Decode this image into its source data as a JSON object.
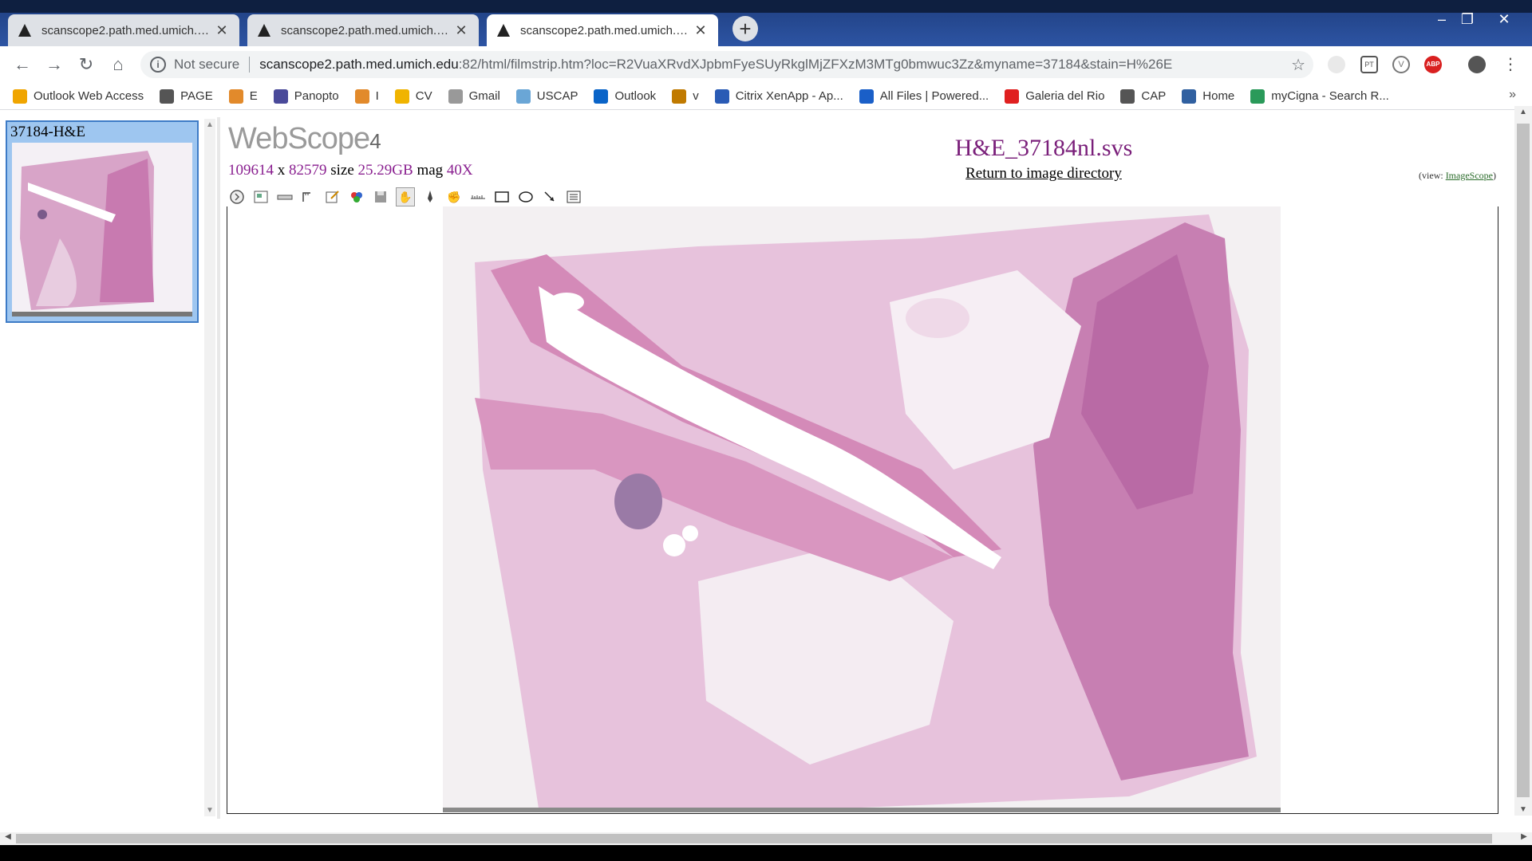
{
  "tabs": [
    {
      "title": "scanscope2.path.med.umich.edu",
      "active": false
    },
    {
      "title": "scanscope2.path.med.umich.edu",
      "active": false
    },
    {
      "title": "scanscope2.path.med.umich.edu",
      "active": true
    }
  ],
  "address": {
    "security": "Not secure",
    "host": "scanscope2.path.med.umich.edu",
    "path": ":82/html/filmstrip.htm?loc=R2VuaXRvdXJpbmFyeSUyRkglMjZFXzM3MTg0bmwuc3Zz&myname=37184&stain=H%26E"
  },
  "bookmarks": [
    {
      "label": "Outlook Web Access",
      "icon": "outlook-square-icon",
      "color": "#f0a500"
    },
    {
      "label": "PAGE",
      "icon": "globe-icon",
      "color": "#555555"
    },
    {
      "label": "E",
      "icon": "e-letter-icon",
      "color": "#e28a2b"
    },
    {
      "label": "Panopto",
      "icon": "panopto-icon",
      "color": "#4a4a9a"
    },
    {
      "label": "I",
      "icon": "e-letter-icon",
      "color": "#e28a2b"
    },
    {
      "label": "CV",
      "icon": "folder-people-icon",
      "color": "#f0b400"
    },
    {
      "label": "Gmail",
      "icon": "loading-icon",
      "color": "#999999"
    },
    {
      "label": "USCAP",
      "icon": "cloud-icon",
      "color": "#6aa6d6"
    },
    {
      "label": "Outlook",
      "icon": "outlook-icon",
      "color": "#0a64c8"
    },
    {
      "label": "v",
      "icon": "v-letter-icon",
      "color": "#c07a00"
    },
    {
      "label": "Citrix XenApp - Ap...",
      "icon": "citrix-icon",
      "color": "#2a5bb5"
    },
    {
      "label": "All Files | Powered...",
      "icon": "box-icon",
      "color": "#1a5fc8"
    },
    {
      "label": "Galeria del Rio",
      "icon": "red-square-icon",
      "color": "#e02020"
    },
    {
      "label": "CAP",
      "icon": "globe-icon",
      "color": "#555555"
    },
    {
      "label": "Home",
      "icon": "ae-icon",
      "color": "#3060a0"
    },
    {
      "label": "myCigna - Search R...",
      "icon": "cigna-tree-icon",
      "color": "#2a9a5a"
    }
  ],
  "filmstrip": {
    "items": [
      {
        "label": "37184-H&E"
      }
    ]
  },
  "viewer": {
    "logo": "WebScope",
    "logo_version": "4",
    "width": "109614",
    "x": "x",
    "height": "82579",
    "size_label": "size",
    "size": "25.29GB",
    "mag_label": "mag",
    "mag": "40X",
    "image_title": "H&E_37184nl.svs",
    "return_link": "Return to image directory",
    "view_prefix": "(view: ",
    "view_link": "ImageScope",
    "view_suffix": ")"
  },
  "tools": [
    "fullscreen-icon",
    "thumbnail-icon",
    "zoom-slider-icon",
    "ruler-icon",
    "annotation-edit-icon",
    "color-icon",
    "save-icon",
    "pan-hand-icon",
    "pen-icon",
    "hand-lock-icon",
    "measure-icon",
    "rectangle-icon",
    "ellipse-icon",
    "arrow-icon",
    "list-icon"
  ]
}
